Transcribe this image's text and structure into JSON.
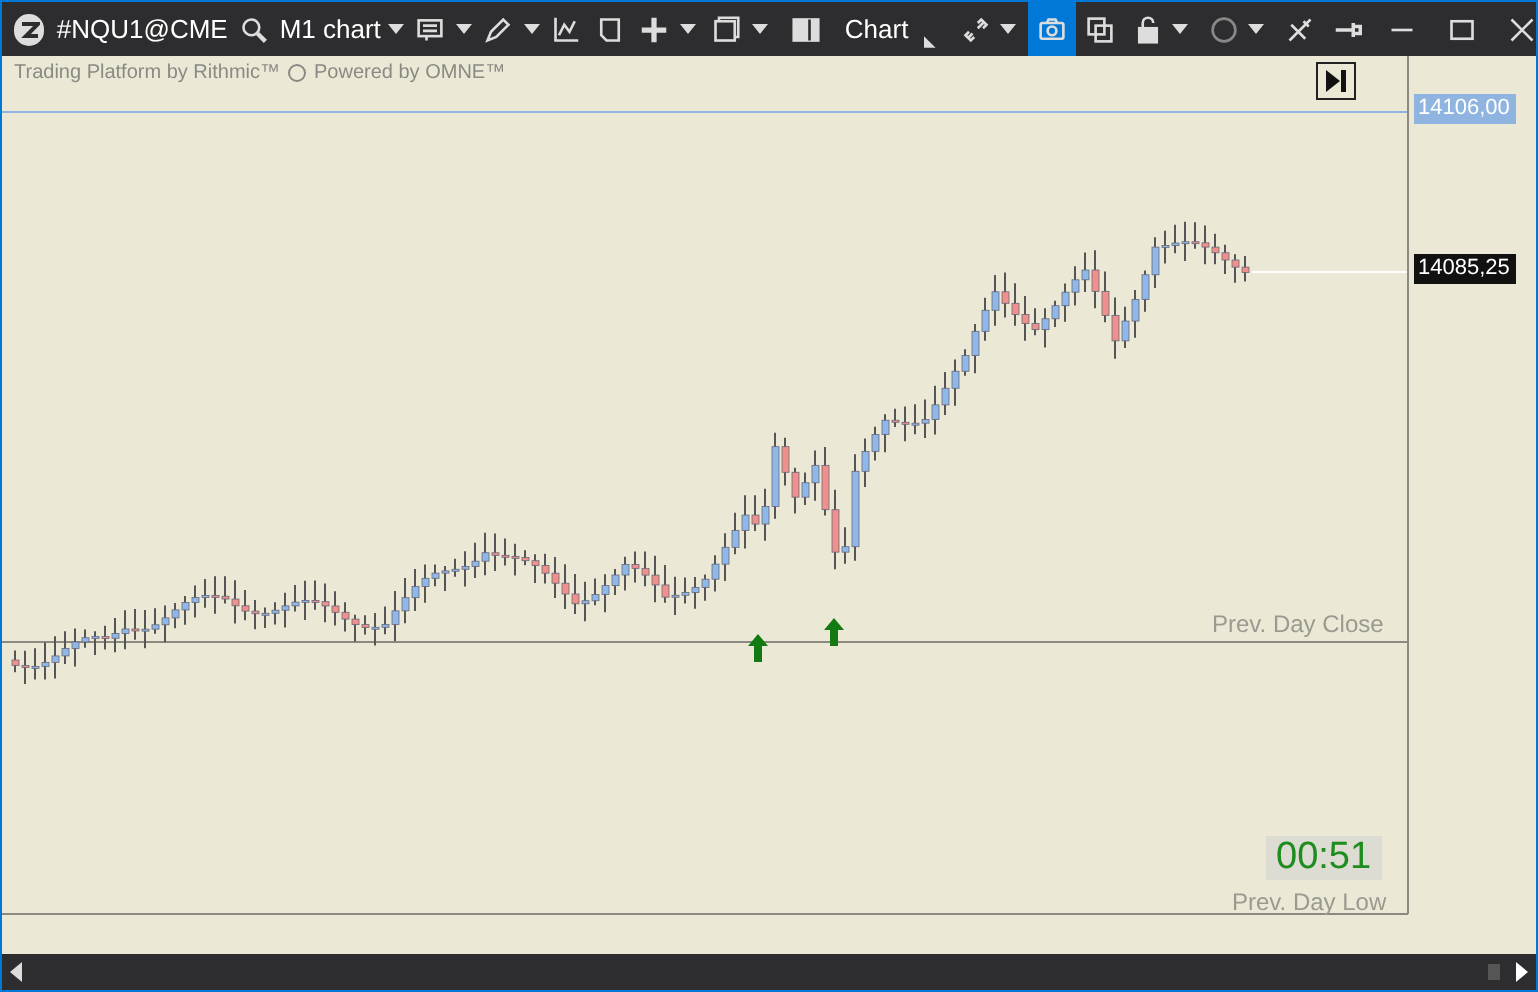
{
  "toolbar": {
    "symbol": "#NQU1@CME",
    "timeframe": "M1 chart",
    "layout_label": "Chart",
    "tools": [
      {
        "kind": "link",
        "selected": false
      },
      {
        "kind": "camera",
        "selected": true
      },
      {
        "kind": "windows",
        "selected": false
      },
      {
        "kind": "lock",
        "selected": false
      },
      {
        "kind": "circle",
        "selected": false
      },
      {
        "kind": "tools",
        "selected": false
      },
      {
        "kind": "pin",
        "selected": false
      }
    ]
  },
  "chart": {
    "credit_left": "Trading Platform by Rithmic™",
    "credit_right": "Powered by OMNE™",
    "price_labels": [
      {
        "text": "14106,00",
        "kind": "line"
      },
      {
        "text": "14085,25",
        "kind": "last"
      }
    ],
    "prev_day_close": "Prev. Day Close",
    "prev_day_low": "Prev. Day Low",
    "timer": "00:51"
  }
}
